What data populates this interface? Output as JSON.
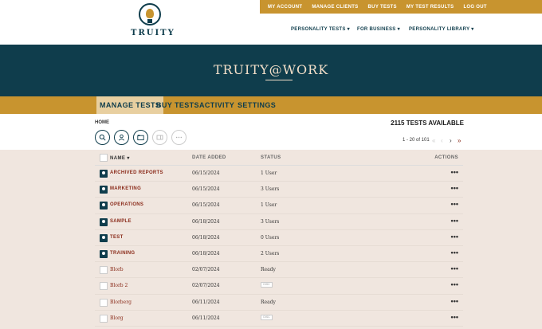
{
  "brand": {
    "name": "TRUITY"
  },
  "topnav": [
    "MY ACCOUNT",
    "MANAGE CLIENTS",
    "BUY TESTS",
    "MY TEST RESULTS",
    "LOG OUT"
  ],
  "mainnav": [
    "PERSONALITY TESTS ▾",
    "FOR BUSINESS ▾",
    "PERSONALITY LIBRARY ▾"
  ],
  "banner": {
    "title": "TRUITY@WORK"
  },
  "tabs": [
    "MANAGE TESTS",
    "BUY TESTS",
    "ACTIVITY",
    "SETTINGS"
  ],
  "breadcrumb": "HOME",
  "available": "2115 TESTS AVAILABLE",
  "pager": {
    "text": "1 - 20 of 101"
  },
  "table": {
    "headers": {
      "name": "NAME ▾",
      "date": "DATE ADDED",
      "status": "STATUS",
      "actions": "ACTIONS"
    },
    "rows": [
      {
        "kind": "group",
        "name": "ARCHIVED REPORTS",
        "date": "06/15/2024",
        "status": "1 User"
      },
      {
        "kind": "group",
        "name": "MARKETING",
        "date": "06/15/2024",
        "status": "3 Users"
      },
      {
        "kind": "group",
        "name": "OPERATIONS",
        "date": "06/15/2024",
        "status": "1 User"
      },
      {
        "kind": "group",
        "name": "SAMPLE",
        "date": "06/18/2024",
        "status": "3 Users"
      },
      {
        "kind": "group",
        "name": "TEST",
        "date": "06/18/2024",
        "status": "0 Users"
      },
      {
        "kind": "group",
        "name": "TRAINING",
        "date": "06/18/2024",
        "status": "2 Users"
      },
      {
        "kind": "test",
        "name": "Blorb",
        "date": "02/07/2024",
        "status": "Ready"
      },
      {
        "kind": "test",
        "name": "Blorb 2",
        "date": "02/07/2024",
        "status": "",
        "badge": "DISC"
      },
      {
        "kind": "test",
        "name": "Blorberg",
        "date": "06/11/2024",
        "status": "Ready"
      },
      {
        "kind": "test",
        "name": "Blorg",
        "date": "06/11/2024",
        "status": "",
        "badge": "DISC"
      }
    ],
    "actions_glyph": "•••"
  }
}
